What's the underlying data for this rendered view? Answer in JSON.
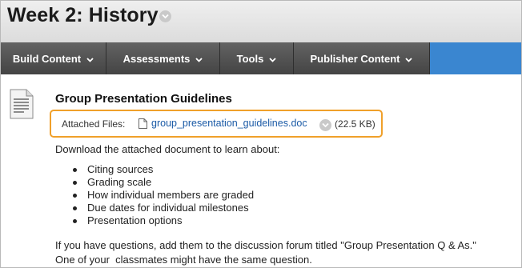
{
  "page": {
    "title": "Week 2: History"
  },
  "menu": {
    "items": [
      {
        "label": "Build Content"
      },
      {
        "label": "Assessments"
      },
      {
        "label": "Tools"
      },
      {
        "label": "Publisher Content"
      }
    ],
    "accent_color": "#3a86d0",
    "bar_color": "#4a4a4a"
  },
  "content_item": {
    "icon": "document-icon",
    "title": "Group Presentation Guidelines",
    "attachment": {
      "label": "Attached Files:",
      "file_name": "group_presentation_guidelines.doc",
      "size": "(22.5 KB)",
      "highlight_color": "#f0a02a"
    },
    "intro": "Download the attached document to learn about:",
    "topics": [
      "Citing sources",
      "Grading scale",
      "How individual members are graded",
      "Due dates for individual milestones",
      "Presentation options"
    ],
    "closing_line_1": "If you have questions, add them to the discussion forum titled \"Group Presentation Q & As.\"",
    "closing_line_2": "One of your  classmates might have the same question."
  }
}
